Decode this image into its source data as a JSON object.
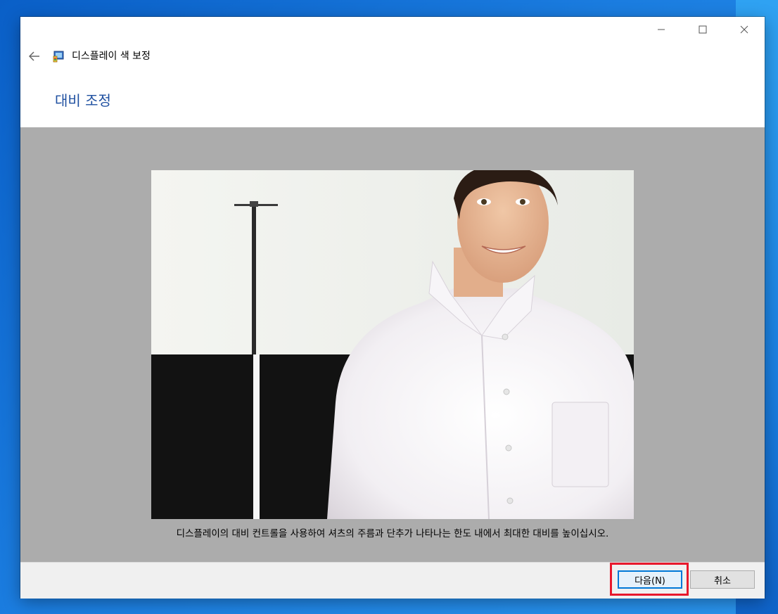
{
  "window": {
    "title": "디스플레이 색 보정",
    "caption_buttons": [
      "minimize-icon",
      "maximize-icon",
      "close-icon"
    ]
  },
  "nav": {
    "back_icon": "back-arrow-icon"
  },
  "page": {
    "heading": "대비 조정",
    "instruction": "디스플레이의 대비 컨트롤을 사용하여 셔츠의 주름과 단추가 나타나는 한도 내에서 최대한 대비를 높이십시오."
  },
  "buttons": {
    "next_label": "다음(N)",
    "cancel_label": "취소"
  },
  "colors": {
    "heading": "#1e4fa0",
    "content_bg": "#acacac",
    "highlight": "#e8182c",
    "focus": "#0078d7"
  }
}
